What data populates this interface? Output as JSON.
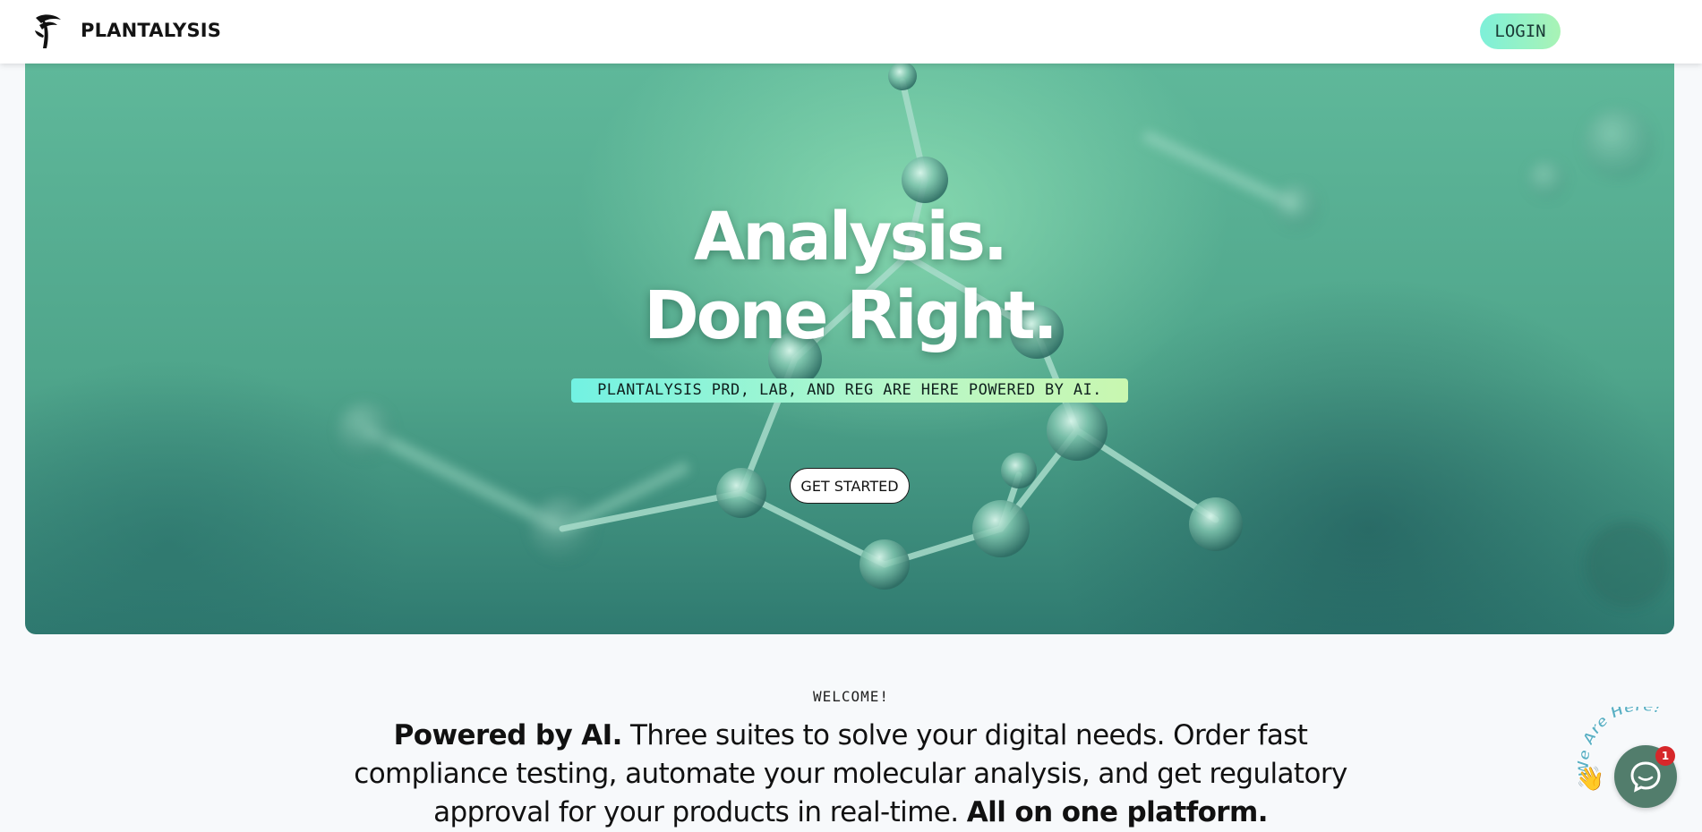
{
  "header": {
    "brand": "PLANTALYSIS",
    "login_label": "LOGIN"
  },
  "hero": {
    "title_line1": "Analysis.",
    "title_line2": "Done Right.",
    "tagline": "PLANTALYSIS PRD, LAB, AND REG ARE HERE POWERED BY AI.",
    "cta_label": "GET STARTED"
  },
  "welcome": {
    "label": "WELCOME!",
    "lead": "Powered by AI.",
    "body": " Three suites to solve your digital needs. Order fast compliance testing, automate your molecular analysis, and get regulatory approval for your products in real-time. ",
    "closing": "All on one platform."
  },
  "chat": {
    "arc_text": "We Are Here!",
    "badge_count": "1",
    "wave_icon": "waving-hand-icon",
    "bubble_icon": "chat-bubble-icon"
  },
  "colors": {
    "accent_gradient_start": "#72f2e2",
    "accent_gradient_end": "#c9f7b0",
    "chat_green": "#527d6c",
    "badge_red": "#d6272a"
  }
}
